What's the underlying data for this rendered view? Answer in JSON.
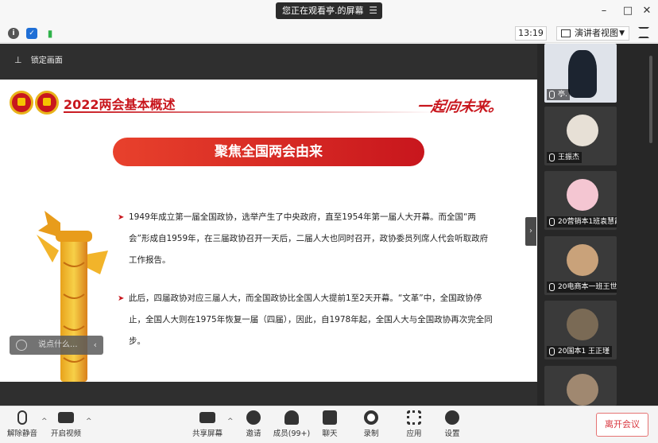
{
  "window": {
    "title": "您正在观看亭.的屏幕"
  },
  "infobar": {
    "time": "13:19",
    "view_mode": "演讲者视图"
  },
  "share": {
    "lock_label": "锁定画面"
  },
  "slide": {
    "title": "2022两会基本概述",
    "slogan": "一起向未来。",
    "banner": "聚焦全国两会由来",
    "paragraph1": "1949年成立第一届全国政协，选举产生了中央政府，直至1954年第一届人大开幕。而全国“两会”形成自1959年，在三届政协召开一天后，二届人大也同时召开，政协委员列席人代会听取政府工作报告。",
    "paragraph2": "此后，四届政协对应三届人大，而全国政协比全国人大提前1至2天开幕。“文革”中，全国政协停止，全国人大则在1975年恢复一届（四届），因此，自1978年起，全国人大与全国政协再次完全同步。"
  },
  "chat": {
    "placeholder": "说点什么..."
  },
  "participants": [
    {
      "name": "亭.",
      "bg": "#dfe3ea",
      "avatar": "#1c2430"
    },
    {
      "name": "王振杰",
      "bg": "#3a3a3a",
      "avatar": "#e7e0d6"
    },
    {
      "name": "20营销本1班袁慧霞",
      "bg": "#3a3a3a",
      "avatar": "#f4c6d2"
    },
    {
      "name": "20电商本一班王世昱",
      "bg": "#3a3a3a",
      "avatar": "#c9a27a"
    },
    {
      "name": "20国本1 王正瑾",
      "bg": "#3a3a3a",
      "avatar": "#7a6a55"
    },
    {
      "name": "",
      "bg": "#3a3a3a",
      "avatar": "#a08870"
    }
  ],
  "toolbar": {
    "mute": "解除静音",
    "video": "开启视频",
    "share_screen": "共享屏幕",
    "invite": "邀请",
    "members": "成员(99+)",
    "chat": "聊天",
    "record": "录制",
    "apps": "应用",
    "settings": "设置",
    "leave": "离开会议"
  },
  "colors": {
    "accent_red": "#c8161d",
    "banner_red": "#e8412c",
    "leave_red": "#d9363e",
    "signal_green": "#2fb24a",
    "shield_blue": "#1f6fd6"
  },
  "icons": [
    "info-icon",
    "shield-icon",
    "signal-icon",
    "pin-icon",
    "mic-muted-icon",
    "video-off-icon",
    "share-screen-icon",
    "invite-icon",
    "members-icon",
    "chat-icon",
    "record-icon",
    "apps-icon",
    "settings-icon",
    "minimize-icon",
    "maximize-icon",
    "close-icon",
    "fullscreen-icon",
    "emoji-icon"
  ]
}
